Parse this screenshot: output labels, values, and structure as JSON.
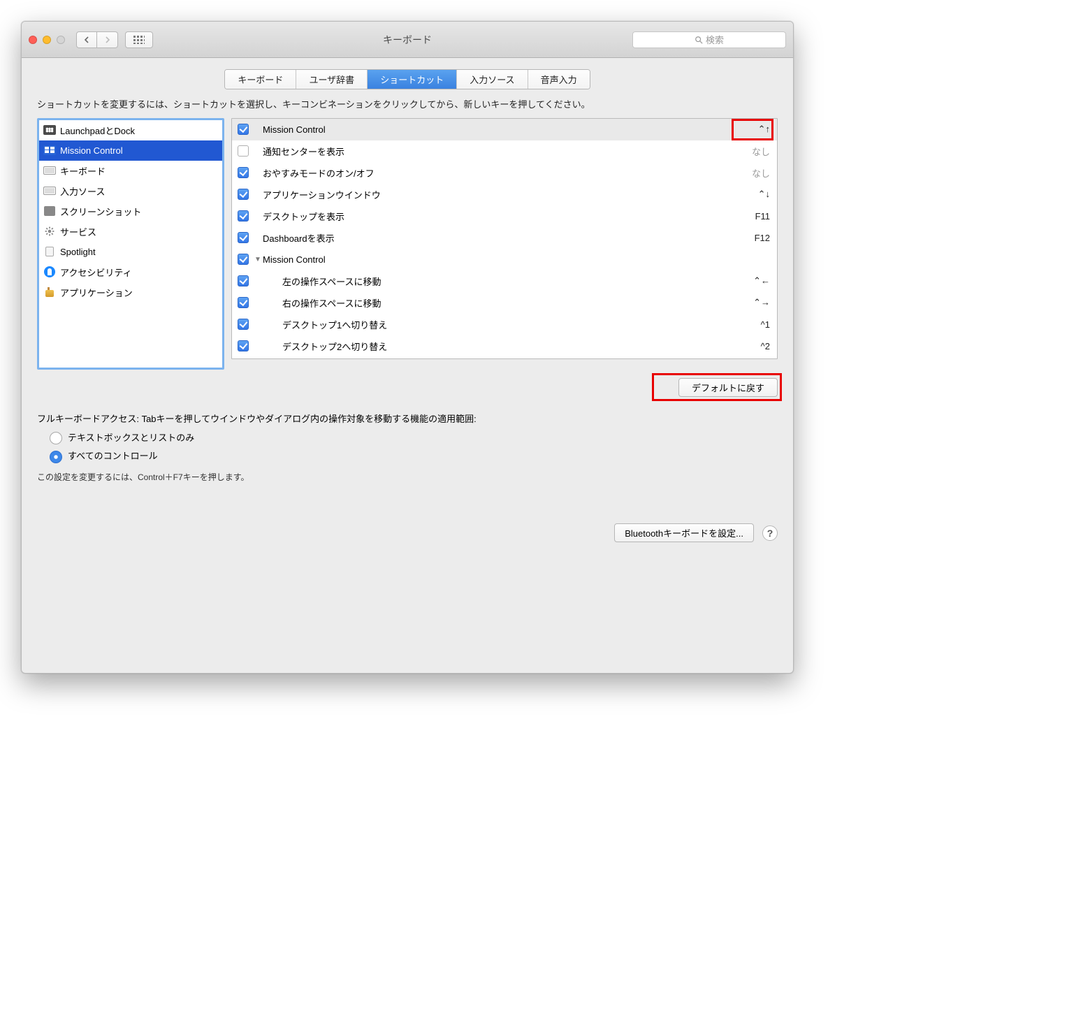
{
  "window": {
    "title": "キーボード",
    "search_placeholder": "検索"
  },
  "tabs": [
    {
      "label": "キーボード",
      "selected": false
    },
    {
      "label": "ユーザ辞書",
      "selected": false
    },
    {
      "label": "ショートカット",
      "selected": true
    },
    {
      "label": "入力ソース",
      "selected": false
    },
    {
      "label": "音声入力",
      "selected": false
    }
  ],
  "instruction": "ショートカットを変更するには、ショートカットを選択し、キーコンビネーションをクリックしてから、新しいキーを押してください。",
  "categories": [
    {
      "label": "LaunchpadとDock",
      "icon": "launchpad",
      "selected": false
    },
    {
      "label": "Mission Control",
      "icon": "mission-control",
      "selected": true
    },
    {
      "label": "キーボード",
      "icon": "keyboard",
      "selected": false
    },
    {
      "label": "入力ソース",
      "icon": "keyboard",
      "selected": false
    },
    {
      "label": "スクリーンショット",
      "icon": "screenshot",
      "selected": false
    },
    {
      "label": "サービス",
      "icon": "gear",
      "selected": false
    },
    {
      "label": "Spotlight",
      "icon": "spotlight",
      "selected": false
    },
    {
      "label": "アクセシビリティ",
      "icon": "accessibility",
      "selected": false
    },
    {
      "label": "アプリケーション",
      "icon": "application",
      "selected": false
    }
  ],
  "shortcuts": [
    {
      "checked": true,
      "name": "Mission Control",
      "binding": "⌃↑",
      "grey": false,
      "head": true,
      "indent": 0,
      "disclosure": ""
    },
    {
      "checked": false,
      "name": "通知センターを表示",
      "binding": "なし",
      "grey": true,
      "head": false,
      "indent": 0,
      "disclosure": ""
    },
    {
      "checked": true,
      "name": "おやすみモードのオン/オフ",
      "binding": "なし",
      "grey": true,
      "head": false,
      "indent": 0,
      "disclosure": ""
    },
    {
      "checked": true,
      "name": "アプリケーションウインドウ",
      "binding": "⌃↓",
      "grey": false,
      "head": false,
      "indent": 0,
      "disclosure": ""
    },
    {
      "checked": true,
      "name": "デスクトップを表示",
      "binding": "F11",
      "grey": false,
      "head": false,
      "indent": 0,
      "disclosure": ""
    },
    {
      "checked": true,
      "name": "Dashboardを表示",
      "binding": "F12",
      "grey": false,
      "head": false,
      "indent": 0,
      "disclosure": ""
    },
    {
      "checked": true,
      "name": "Mission Control",
      "binding": "",
      "grey": false,
      "head": false,
      "indent": 0,
      "disclosure": "▼"
    },
    {
      "checked": true,
      "name": "左の操作スペースに移動",
      "binding": "⌃←",
      "grey": false,
      "head": false,
      "indent": 1,
      "disclosure": ""
    },
    {
      "checked": true,
      "name": "右の操作スペースに移動",
      "binding": "⌃→",
      "grey": false,
      "head": false,
      "indent": 1,
      "disclosure": ""
    },
    {
      "checked": true,
      "name": "デスクトップ1へ切り替え",
      "binding": "^1",
      "grey": false,
      "head": false,
      "indent": 1,
      "disclosure": ""
    },
    {
      "checked": true,
      "name": "デスクトップ2へ切り替え",
      "binding": "^2",
      "grey": false,
      "head": false,
      "indent": 1,
      "disclosure": ""
    }
  ],
  "reset_label": "デフォルトに戻す",
  "fka": {
    "text": "フルキーボードアクセス: Tabキーを押してウインドウやダイアログ内の操作対象を移動する機能の適用範囲:",
    "options": [
      {
        "label": "テキストボックスとリストのみ",
        "on": false
      },
      {
        "label": "すべてのコントロール",
        "on": true
      }
    ],
    "hint": "この設定を変更するには、Control＋F7キーを押します。"
  },
  "footer": {
    "bluetooth_label": "Bluetoothキーボードを設定...",
    "help_label": "?"
  }
}
